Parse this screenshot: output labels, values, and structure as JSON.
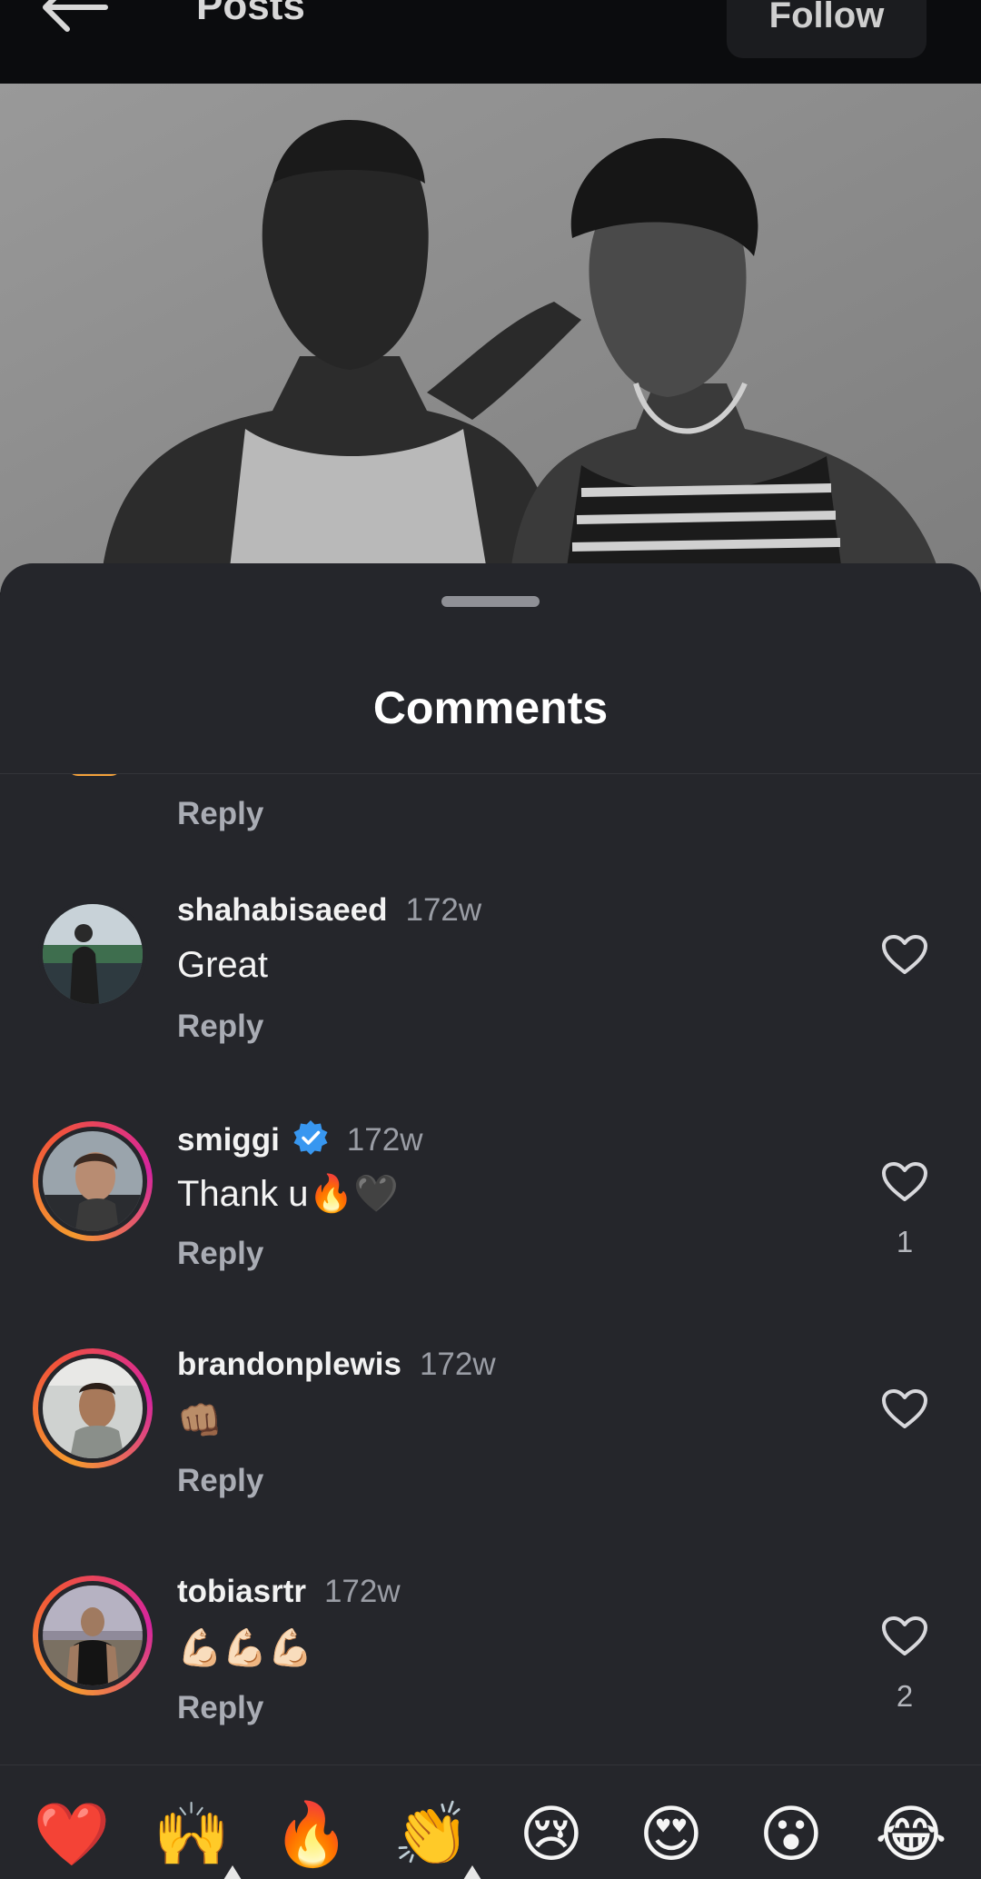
{
  "header": {
    "title": "Posts",
    "follow_label": "Follow"
  },
  "sheet": {
    "title": "Comments",
    "reply_label": "Reply"
  },
  "comments": [
    {
      "username": "shahabisaeed",
      "time": "172w",
      "text": "Great",
      "verified": false,
      "likes": "",
      "has_story_ring": false
    },
    {
      "username": "smiggi",
      "time": "172w",
      "text": "Thank u🔥🖤",
      "verified": true,
      "likes": "1",
      "has_story_ring": true
    },
    {
      "username": "brandonplewis",
      "time": "172w",
      "text": "👊🏽",
      "verified": false,
      "likes": "",
      "has_story_ring": true
    },
    {
      "username": "tobiasrtr",
      "time": "172w",
      "text": "💪🏻💪🏻💪🏻",
      "verified": false,
      "likes": "2",
      "has_story_ring": true
    }
  ],
  "emoji_bar": {
    "items": [
      "❤️",
      "🙌",
      "🔥",
      "👏",
      "😢",
      "😍",
      "😮",
      "😂"
    ]
  },
  "colors": {
    "sheet_background": "#25262b",
    "verified_blue": "#3897f0",
    "story_ring_start": "#f59a2e",
    "story_ring_end": "#d6249f"
  }
}
